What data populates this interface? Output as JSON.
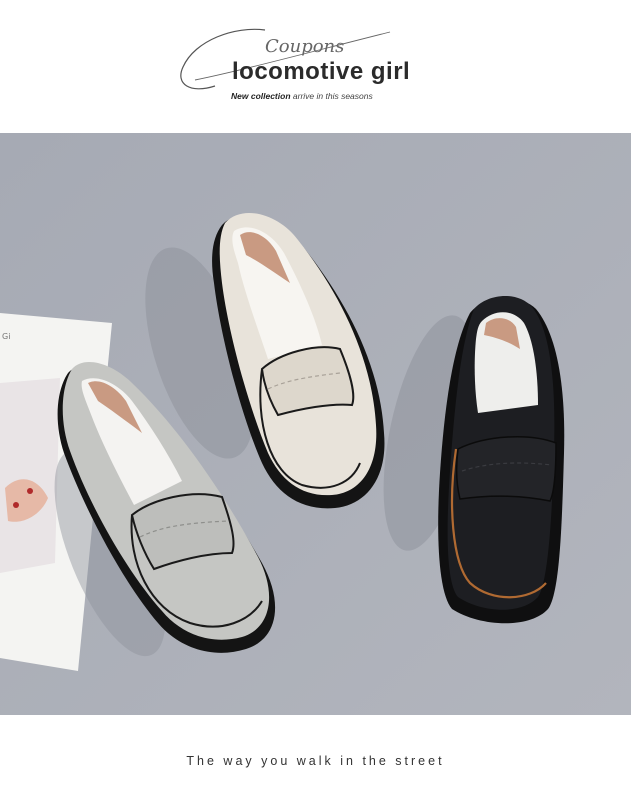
{
  "header": {
    "script_text": "Coupons",
    "title": "locomotive girl",
    "tagline_bold": "New collection",
    "tagline_rest": "arrive in this seasons"
  },
  "photo": {
    "card_text": "Gi",
    "colors": {
      "background": "#a9adb6",
      "shoe_grey": "#c4c5c2",
      "shoe_cream": "#e6e1d8",
      "shoe_black": "#1b1c1f",
      "sole": "#1a1a1a",
      "lining": "#c99a82",
      "accent_brown": "#b06a32"
    }
  },
  "footer": {
    "caption": "The way you walk in the street"
  }
}
